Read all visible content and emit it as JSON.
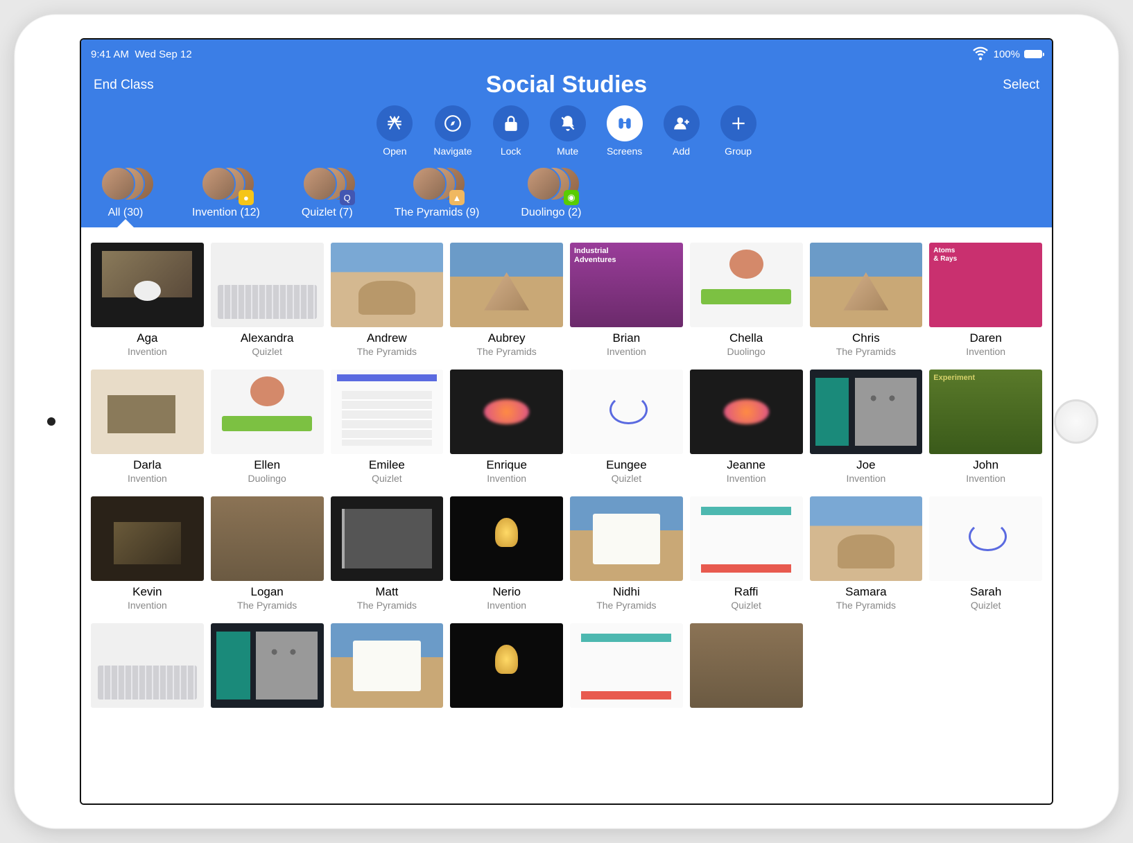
{
  "status": {
    "time": "9:41 AM",
    "date": "Wed Sep 12",
    "battery": "100%"
  },
  "nav": {
    "left": "End Class",
    "title": "Social Studies",
    "right": "Select"
  },
  "actions": [
    {
      "id": "open",
      "label": "Open",
      "icon": "appstore",
      "active": false
    },
    {
      "id": "navigate",
      "label": "Navigate",
      "icon": "compass",
      "active": false
    },
    {
      "id": "lock",
      "label": "Lock",
      "icon": "lock",
      "active": false
    },
    {
      "id": "mute",
      "label": "Mute",
      "icon": "bell-slash",
      "active": false
    },
    {
      "id": "screens",
      "label": "Screens",
      "icon": "binoculars",
      "active": true
    },
    {
      "id": "add",
      "label": "Add",
      "icon": "person-plus",
      "active": false
    },
    {
      "id": "group",
      "label": "Group",
      "icon": "plus",
      "active": false
    }
  ],
  "groups": [
    {
      "id": "all",
      "label": "All (30)",
      "badge": null,
      "badgeColor": null,
      "active": true
    },
    {
      "id": "invention",
      "label": "Invention (12)",
      "badge": "●",
      "badgeColor": "#f5c518"
    },
    {
      "id": "quizlet",
      "label": "Quizlet (7)",
      "badge": "Q",
      "badgeColor": "#4257b2"
    },
    {
      "id": "pyramids",
      "label": "The Pyramids (9)",
      "badge": "▲",
      "badgeColor": "#f0b860"
    },
    {
      "id": "duolingo",
      "label": "Duolingo (2)",
      "badge": "◉",
      "badgeColor": "#58cc02"
    }
  ],
  "students": [
    {
      "name": "Aga",
      "app": "Invention",
      "thumb": "moon"
    },
    {
      "name": "Alexandra",
      "app": "Quizlet",
      "thumb": "keyboard"
    },
    {
      "name": "Andrew",
      "app": "The Pyramids",
      "thumb": "sphinx"
    },
    {
      "name": "Aubrey",
      "app": "The Pyramids",
      "thumb": "pyramid"
    },
    {
      "name": "Brian",
      "app": "Invention",
      "thumb": "purple",
      "text": "Industrial\nAdventures"
    },
    {
      "name": "Chella",
      "app": "Duolingo",
      "thumb": "duo"
    },
    {
      "name": "Chris",
      "app": "The Pyramids",
      "thumb": "pyramid"
    },
    {
      "name": "Daren",
      "app": "Invention",
      "thumb": "pink",
      "text": "Atoms\n& Rays"
    },
    {
      "name": "Darla",
      "app": "Invention",
      "thumb": "oldpaper"
    },
    {
      "name": "Ellen",
      "app": "Duolingo",
      "thumb": "duo"
    },
    {
      "name": "Emilee",
      "app": "Quizlet",
      "thumb": "pbar"
    },
    {
      "name": "Enrique",
      "app": "Invention",
      "thumb": "dark"
    },
    {
      "name": "Eungee",
      "app": "Quizlet",
      "thumb": "circle"
    },
    {
      "name": "Jeanne",
      "app": "Invention",
      "thumb": "dark"
    },
    {
      "name": "Joe",
      "app": "Invention",
      "thumb": "panel"
    },
    {
      "name": "John",
      "app": "Invention",
      "thumb": "green",
      "text": "Experiment"
    },
    {
      "name": "Kevin",
      "app": "Invention",
      "thumb": "dark3d"
    },
    {
      "name": "Logan",
      "app": "The Pyramids",
      "thumb": "stone"
    },
    {
      "name": "Matt",
      "app": "The Pyramids",
      "thumb": "darkcard"
    },
    {
      "name": "Nerio",
      "app": "Invention",
      "thumb": "bulb"
    },
    {
      "name": "Nidhi",
      "app": "The Pyramids",
      "thumb": "modal"
    },
    {
      "name": "Raffi",
      "app": "Quizlet",
      "thumb": "quiz"
    },
    {
      "name": "Samara",
      "app": "The Pyramids",
      "thumb": "sphinx"
    },
    {
      "name": "Sarah",
      "app": "Quizlet",
      "thumb": "circle"
    },
    {
      "name": "",
      "app": "",
      "thumb": "keyboard"
    },
    {
      "name": "",
      "app": "",
      "thumb": "panel"
    },
    {
      "name": "",
      "app": "",
      "thumb": "modal"
    },
    {
      "name": "",
      "app": "",
      "thumb": "bulb"
    },
    {
      "name": "",
      "app": "",
      "thumb": "quiz"
    },
    {
      "name": "",
      "app": "",
      "thumb": "stone"
    }
  ]
}
